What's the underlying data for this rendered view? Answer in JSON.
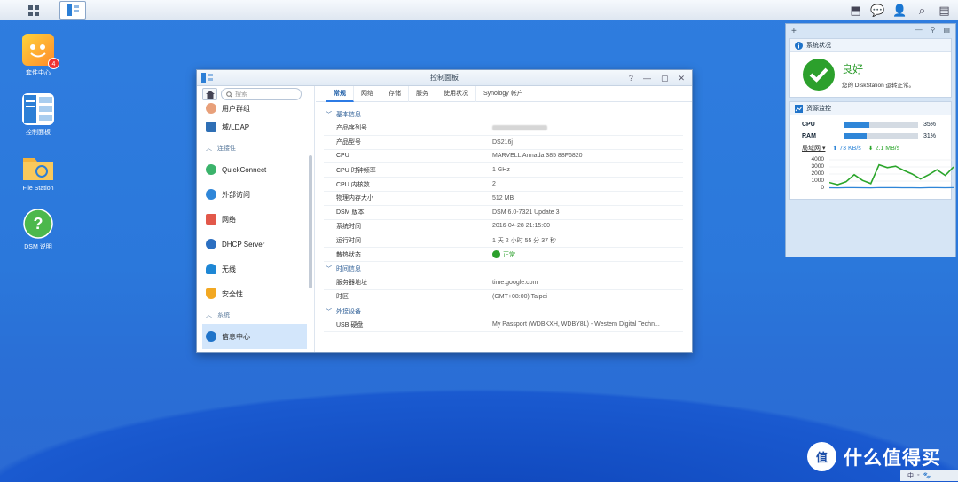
{
  "desktop": {
    "icons": [
      {
        "label": "套件中心",
        "badge": "4"
      },
      {
        "label": "控制面板"
      },
      {
        "label": "File Station"
      },
      {
        "label": "DSM 说明"
      }
    ]
  },
  "window": {
    "title": "控制面板",
    "search_placeholder": "搜索",
    "sidebar": {
      "items": [
        {
          "label": "用户群组",
          "type": "item"
        },
        {
          "label": "域/LDAP",
          "type": "item"
        },
        {
          "label": "连接性",
          "type": "group"
        },
        {
          "label": "QuickConnect",
          "type": "item"
        },
        {
          "label": "外部访问",
          "type": "item"
        },
        {
          "label": "网络",
          "type": "item"
        },
        {
          "label": "DHCP Server",
          "type": "item"
        },
        {
          "label": "无线",
          "type": "item"
        },
        {
          "label": "安全性",
          "type": "item"
        },
        {
          "label": "系统",
          "type": "group"
        },
        {
          "label": "信息中心",
          "type": "item",
          "active": true
        }
      ]
    },
    "tabs": [
      "常规",
      "网络",
      "存储",
      "服务",
      "使用状况",
      "Synology 帐户"
    ],
    "sections": {
      "basic": {
        "title": "基本信息",
        "rows": [
          {
            "label": "产品序列号",
            "value": ""
          },
          {
            "label": "产品型号",
            "value": "DS216j"
          },
          {
            "label": "CPU",
            "value": "MARVELL Armada 385 88F6820"
          },
          {
            "label": "CPU 时钟频率",
            "value": "1 GHz"
          },
          {
            "label": "CPU 内核数",
            "value": "2"
          },
          {
            "label": "物理内存大小",
            "value": "512 MB"
          },
          {
            "label": "DSM 版本",
            "value": "DSM 6.0-7321 Update 3"
          },
          {
            "label": "系统时间",
            "value": "2016-04-28 21:15:00"
          },
          {
            "label": "运行时间",
            "value": "1 天 2 小时 55 分 37 秒"
          },
          {
            "label": "散热状态",
            "value": "正常"
          }
        ]
      },
      "time": {
        "title": "时间信息",
        "rows": [
          {
            "label": "服务器地址",
            "value": "time.google.com"
          },
          {
            "label": "时区",
            "value": "(GMT+08:00) Taipei"
          }
        ]
      },
      "external": {
        "title": "外接设备",
        "rows": [
          {
            "label": "USB 硬盘",
            "value": "My Passport (WDBKXH, WDBY8L) - Western Digital Techn..."
          }
        ]
      }
    }
  },
  "widgets": {
    "status": {
      "title": "系统状况",
      "state": "良好",
      "message": "您的 DiskStation 运转正常。"
    },
    "resource": {
      "title": "资源监控",
      "cpu_label": "CPU",
      "cpu_pct": 35,
      "cpu_text": "35%",
      "ram_label": "RAM",
      "ram_pct": 31,
      "ram_text": "31%",
      "net_label": "局域网",
      "upload": "73 KB/s",
      "download": "2.1 MB/s",
      "y_ticks": [
        "4000",
        "3000",
        "2000",
        "1000",
        "0"
      ]
    }
  },
  "chart_data": {
    "type": "line",
    "ylim": [
      0,
      4000
    ],
    "series": [
      {
        "values": [
          800,
          500,
          900,
          1900,
          1100,
          650,
          3300,
          2900,
          3100,
          2500,
          2000,
          1300,
          1900,
          2600,
          1800,
          3000
        ]
      },
      {
        "values": [
          60,
          50,
          70,
          80,
          60,
          50,
          90,
          80,
          70,
          60,
          60,
          50,
          70,
          80,
          60,
          70
        ]
      }
    ],
    "colors": [
      "#2aa52a",
      "#2f86d8"
    ]
  },
  "watermark": {
    "text": "什么值得买",
    "logo": "值"
  },
  "tray": {
    "items": [
      "中",
      "◦",
      "🐾"
    ]
  }
}
